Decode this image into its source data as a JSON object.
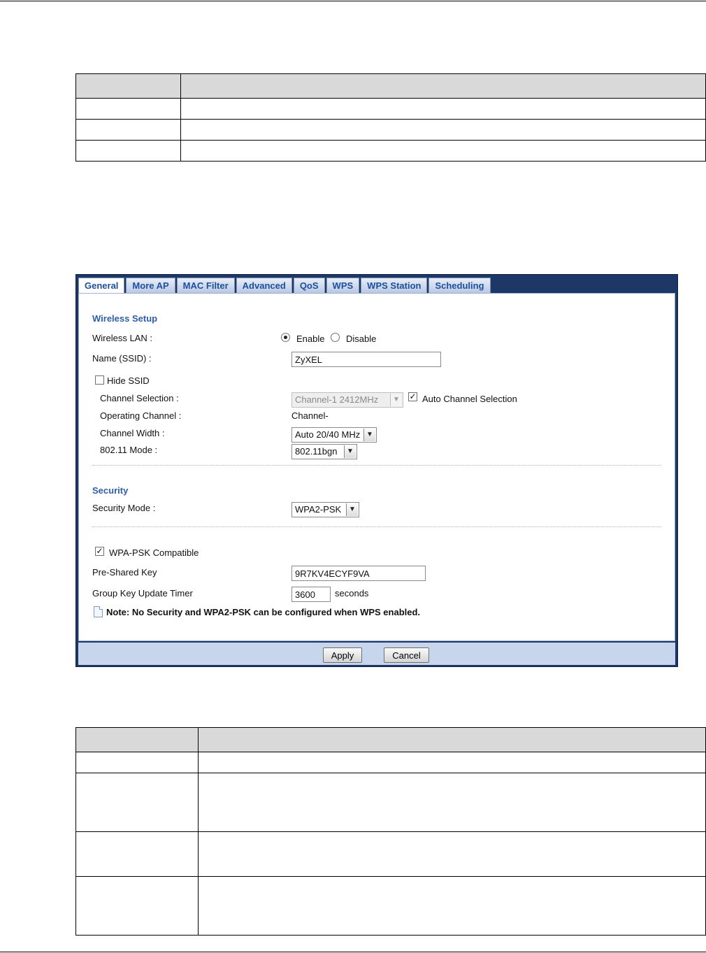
{
  "tabs": [
    "General",
    "More AP",
    "MAC Filter",
    "Advanced",
    "QoS",
    "WPS",
    "WPS Station",
    "Scheduling"
  ],
  "wireless_setup": {
    "heading": "Wireless Setup",
    "wireless_lan_label": "Wireless LAN :",
    "enable_label": "Enable",
    "disable_label": "Disable",
    "enabled": true,
    "ssid_label": "Name (SSID) :",
    "ssid_value": "ZyXEL",
    "hide_ssid_label": "Hide SSID",
    "hide_ssid_checked": false,
    "channel_selection_label": "Channel Selection :",
    "channel_selection_value": "Channel-1 2412MHz",
    "auto_channel_label": "Auto Channel Selection",
    "auto_channel_checked": true,
    "operating_channel_label": "Operating Channel :",
    "operating_channel_value": "Channel-",
    "channel_width_label": "Channel Width :",
    "channel_width_value": "Auto 20/40 MHz",
    "mode_label": "802.11 Mode :",
    "mode_value": "802.11bgn"
  },
  "security": {
    "heading": "Security",
    "mode_label": "Security Mode :",
    "mode_value": "WPA2-PSK",
    "wpa_compatible_label": "WPA-PSK Compatible",
    "wpa_compatible_checked": true,
    "psk_label": "Pre-Shared Key",
    "psk_value": "9R7KV4ECYF9VA",
    "timer_label": "Group Key Update Timer",
    "timer_value": "3600",
    "timer_unit": "seconds",
    "note": "Note: No Security and WPA2-PSK can be configured when WPS enabled."
  },
  "buttons": {
    "apply": "Apply",
    "cancel": "Cancel"
  },
  "colors": {
    "frame": "#1d3766",
    "tab_text": "#1d4f9c",
    "section_heading": "#2f5ea8",
    "footer": "#c7d6ec",
    "table_header": "#d9d9d9"
  }
}
